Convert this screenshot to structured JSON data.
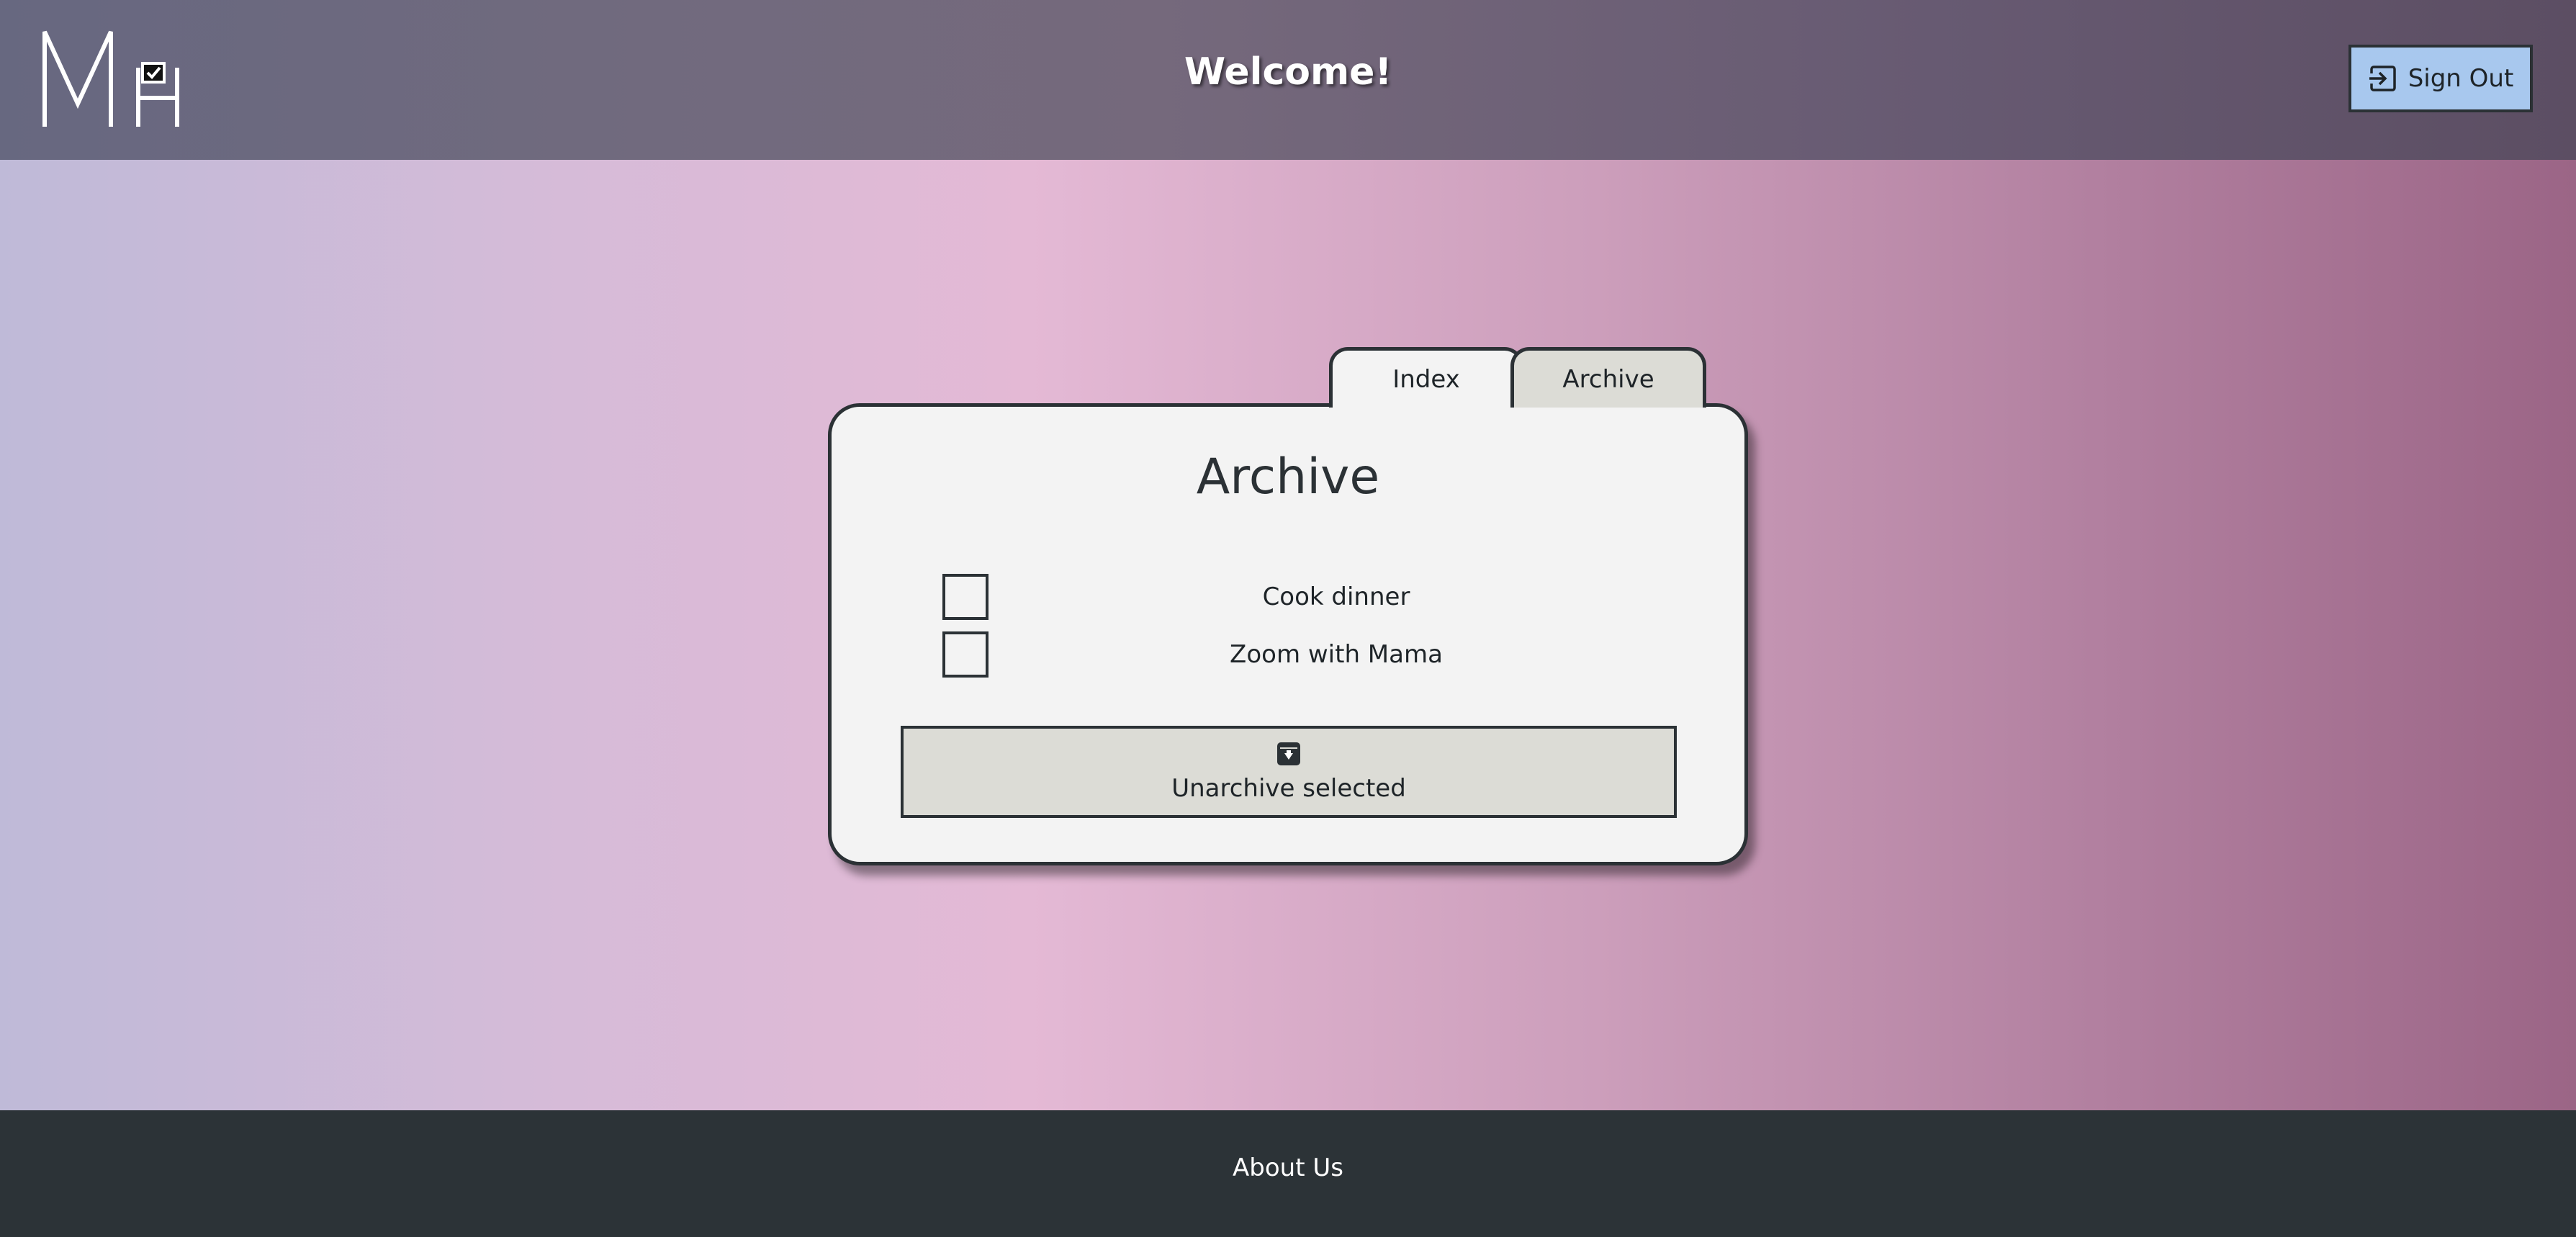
{
  "header": {
    "logo_icon": "mh-checkbox-logo",
    "welcome_text": "Welcome!",
    "signout_icon": "sign-out-icon",
    "signout_label": "Sign Out"
  },
  "tabs": [
    {
      "label": "Index",
      "active": false
    },
    {
      "label": "Archive",
      "active": true
    }
  ],
  "card": {
    "title": "Archive",
    "items": [
      {
        "label": "Cook dinner",
        "checked": false
      },
      {
        "label": "Zoom with Mama",
        "checked": false
      }
    ],
    "unarchive_button": {
      "icon": "unarchive-icon",
      "label": "Unarchive selected"
    }
  },
  "footer": {
    "about_label": "About Us"
  },
  "colors": {
    "header_bg": "#6e687e",
    "signout_bg": "#a8c8ee",
    "card_bg": "#f3f3f3",
    "button_bg": "#dcdcd6",
    "border": "#2b3135",
    "footer_bg": "#2c3337"
  }
}
